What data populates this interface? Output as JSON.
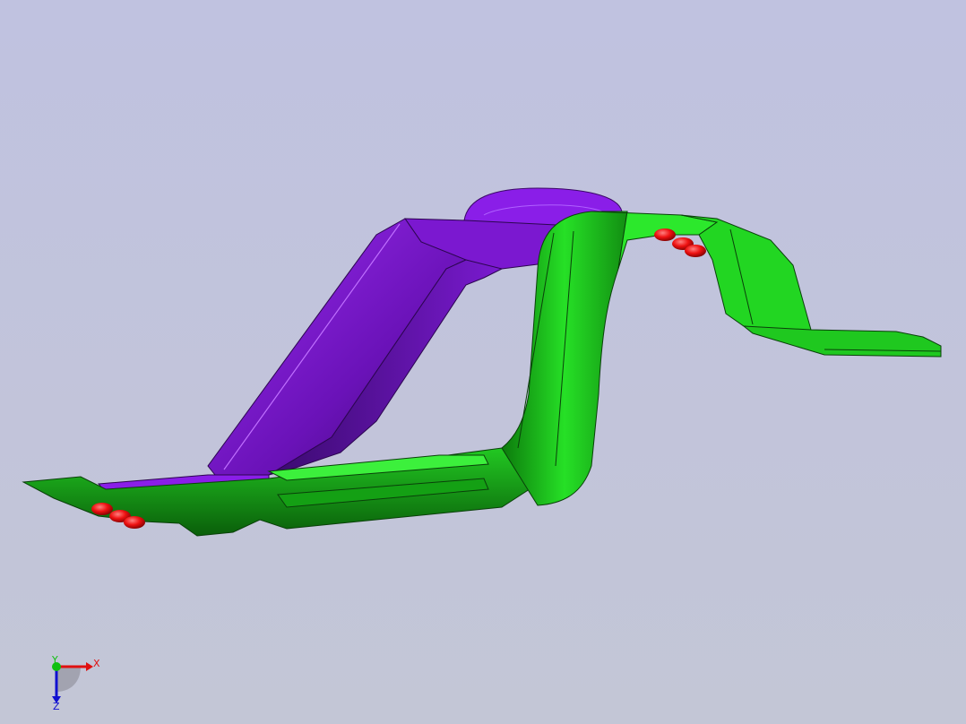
{
  "viewport": {
    "background_top": "#c0c2e0",
    "background_bottom": "#c3c6d6"
  },
  "parts": {
    "purple_part": {
      "color": "#8b1fe0",
      "shade": "#4a0d8a"
    },
    "green_part": {
      "color": "#22d622",
      "shade": "#0a5a0a"
    },
    "fasteners": {
      "color": "#ee1111"
    }
  },
  "triad": {
    "x_label": "X",
    "y_label": "Y",
    "z_label": "Z",
    "x_color": "#e01010",
    "y_color": "#10c010",
    "z_color": "#1010d0"
  }
}
